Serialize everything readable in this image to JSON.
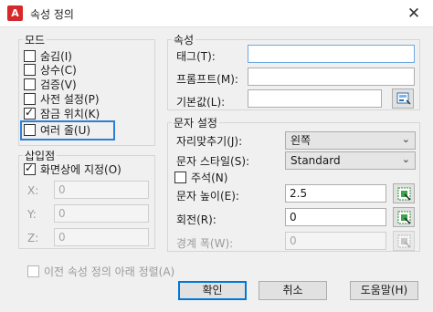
{
  "window": {
    "title": "속성 정의",
    "app_icon_letter": "A",
    "close_glyph": "✕"
  },
  "mode": {
    "heading": "모드",
    "options": [
      {
        "label": "숨김(I)",
        "checked": false
      },
      {
        "label": "상수(C)",
        "checked": false
      },
      {
        "label": "검증(V)",
        "checked": false
      },
      {
        "label": "사전 설정(P)",
        "checked": false
      },
      {
        "label": "잠금 위치(K)",
        "checked": true
      },
      {
        "label": "여러 줄(U)",
        "checked": false
      }
    ]
  },
  "insertion": {
    "heading": "삽입점",
    "on_screen_label": "화면상에 지정(O)",
    "on_screen_checked": true,
    "x_label": "X:",
    "x_value": "0",
    "y_label": "Y:",
    "y_value": "0",
    "z_label": "Z:",
    "z_value": "0"
  },
  "align_below": {
    "label": "이전 속성 정의 아래 정렬(A)",
    "checked": false
  },
  "attribute": {
    "heading": "속성",
    "tag_label": "태그(T):",
    "tag_value": "",
    "prompt_label": "프롬프트(M):",
    "prompt_value": "",
    "default_label": "기본값(L):",
    "default_value": ""
  },
  "text_settings": {
    "heading": "문자 설정",
    "justification_label": "자리맞추기(J):",
    "justification_value": "왼쪽",
    "style_label": "문자 스타일(S):",
    "style_value": "Standard",
    "annotative_label": "주석(N)",
    "annotative_checked": false,
    "height_label": "문자 높이(E):",
    "height_value": "2.5",
    "rotation_label": "회전(R):",
    "rotation_value": "0",
    "boundary_label": "경계 폭(W):",
    "boundary_value": "0"
  },
  "buttons": {
    "ok": "확인",
    "cancel": "취소",
    "help": "도움말(H)"
  },
  "icons": {
    "close": "close-icon",
    "insert_field": "insert-field-icon",
    "pick": "pick-point-icon",
    "dropdown": "chevron-down-icon"
  },
  "colors": {
    "focus_ring": "#2b7fd6",
    "default_button": "#0078d7",
    "app_icon": "#d6282b"
  }
}
